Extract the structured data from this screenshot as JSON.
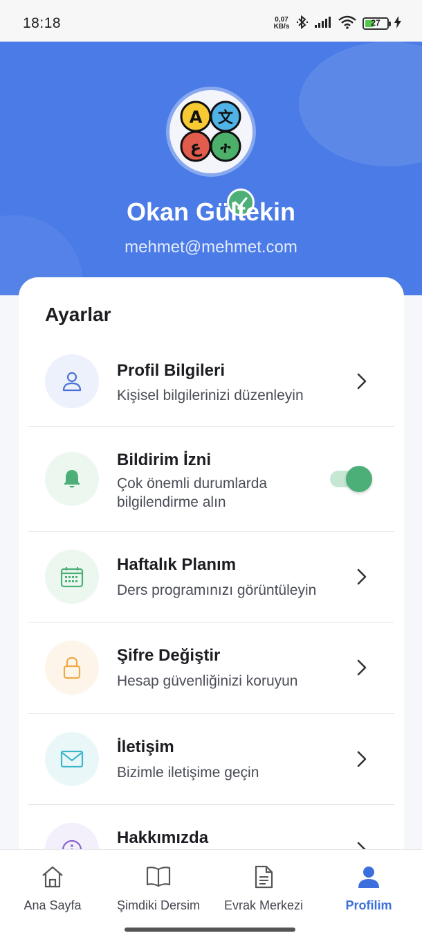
{
  "status_bar": {
    "time": "18:18",
    "net_speed_value": "0,07",
    "net_speed_unit": "KB/s",
    "battery": "27",
    "icons": [
      "bluetooth-icon",
      "signal-icon",
      "wifi-icon",
      "battery-icon",
      "charging-icon"
    ]
  },
  "profile": {
    "name": "Okan Gültekin",
    "email": "mehmet@mehmet.com",
    "avatar_letters": [
      "A",
      "文",
      "ع",
      "ተ"
    ]
  },
  "settings": {
    "title": "Ayarlar",
    "items": [
      {
        "title": "Profil Bilgileri",
        "subtitle": "Kişisel bilgilerinizi düzenleyin",
        "icon": "user-icon",
        "icon_color": "#4a6fd8",
        "icon_bg": "#edf1fb",
        "control": "chevron"
      },
      {
        "title": "Bildirim İzni",
        "subtitle": "Çok önemli durumlarda bilgilendirme alın",
        "icon": "bell-icon",
        "icon_color": "#4caf78",
        "icon_bg": "#ecf7f0",
        "control": "toggle",
        "enabled": true
      },
      {
        "title": "Haftalık Planım",
        "subtitle": "Ders programınızı görüntüleyin",
        "icon": "calendar-icon",
        "icon_color": "#4caf78",
        "icon_bg": "#ecf7f0",
        "control": "chevron"
      },
      {
        "title": "Şifre Değiştir",
        "subtitle": "Hesap güvenliğinizi koruyun",
        "icon": "lock-icon",
        "icon_color": "#f0a945",
        "icon_bg": "#fdf5ea",
        "control": "chevron"
      },
      {
        "title": "İletişim",
        "subtitle": "Bizimle iletişime geçin",
        "icon": "mail-icon",
        "icon_color": "#3cb7c9",
        "icon_bg": "#eaf7f9",
        "control": "chevron"
      },
      {
        "title": "Hakkımızda",
        "subtitle": "",
        "icon": "info-icon",
        "icon_color": "#8a63d2",
        "icon_bg": "#f3effb",
        "control": "chevron"
      }
    ]
  },
  "bottom_nav": {
    "items": [
      {
        "label": "Ana Sayfa",
        "icon": "home-icon",
        "active": false
      },
      {
        "label": "Şimdiki Dersim",
        "icon": "book-icon",
        "active": false
      },
      {
        "label": "Evrak Merkezi",
        "icon": "document-icon",
        "active": false
      },
      {
        "label": "Profilim",
        "icon": "person-icon",
        "active": true
      }
    ]
  },
  "colors": {
    "header_blue": "#4a7be6",
    "active_nav": "#3d6fdc",
    "toggle_on": "#4caf78"
  }
}
